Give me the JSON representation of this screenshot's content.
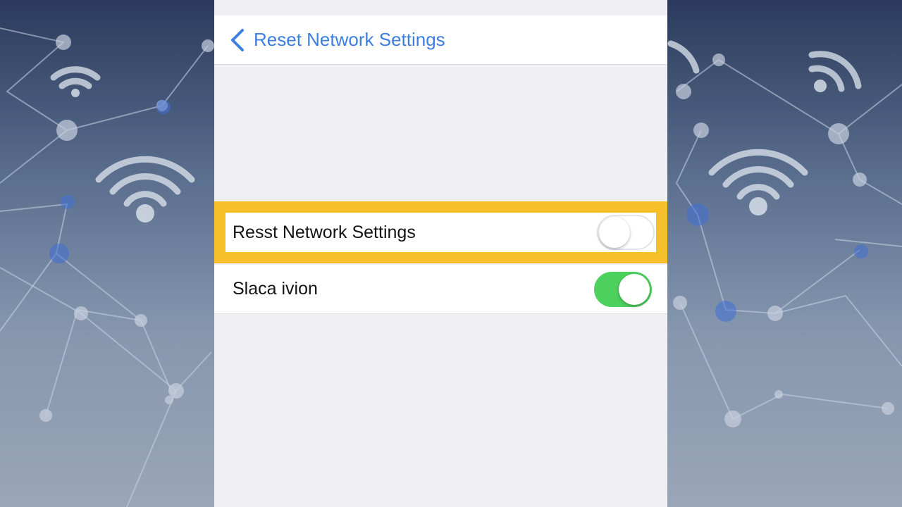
{
  "nav": {
    "back_icon": "chevron-left-icon",
    "title": "Reset Network Settings"
  },
  "settings": {
    "rows": [
      {
        "label": "Resst Network Settings",
        "toggle_on": false,
        "highlighted": true
      },
      {
        "label": "Slaca ivion",
        "toggle_on": true,
        "highlighted": false
      }
    ]
  },
  "colors": {
    "accent_blue": "#3b7fe0",
    "highlight_yellow": "#f6c02b",
    "toggle_on_green": "#4cd05e"
  },
  "background": {
    "decoration": "wifi-network-pattern"
  }
}
